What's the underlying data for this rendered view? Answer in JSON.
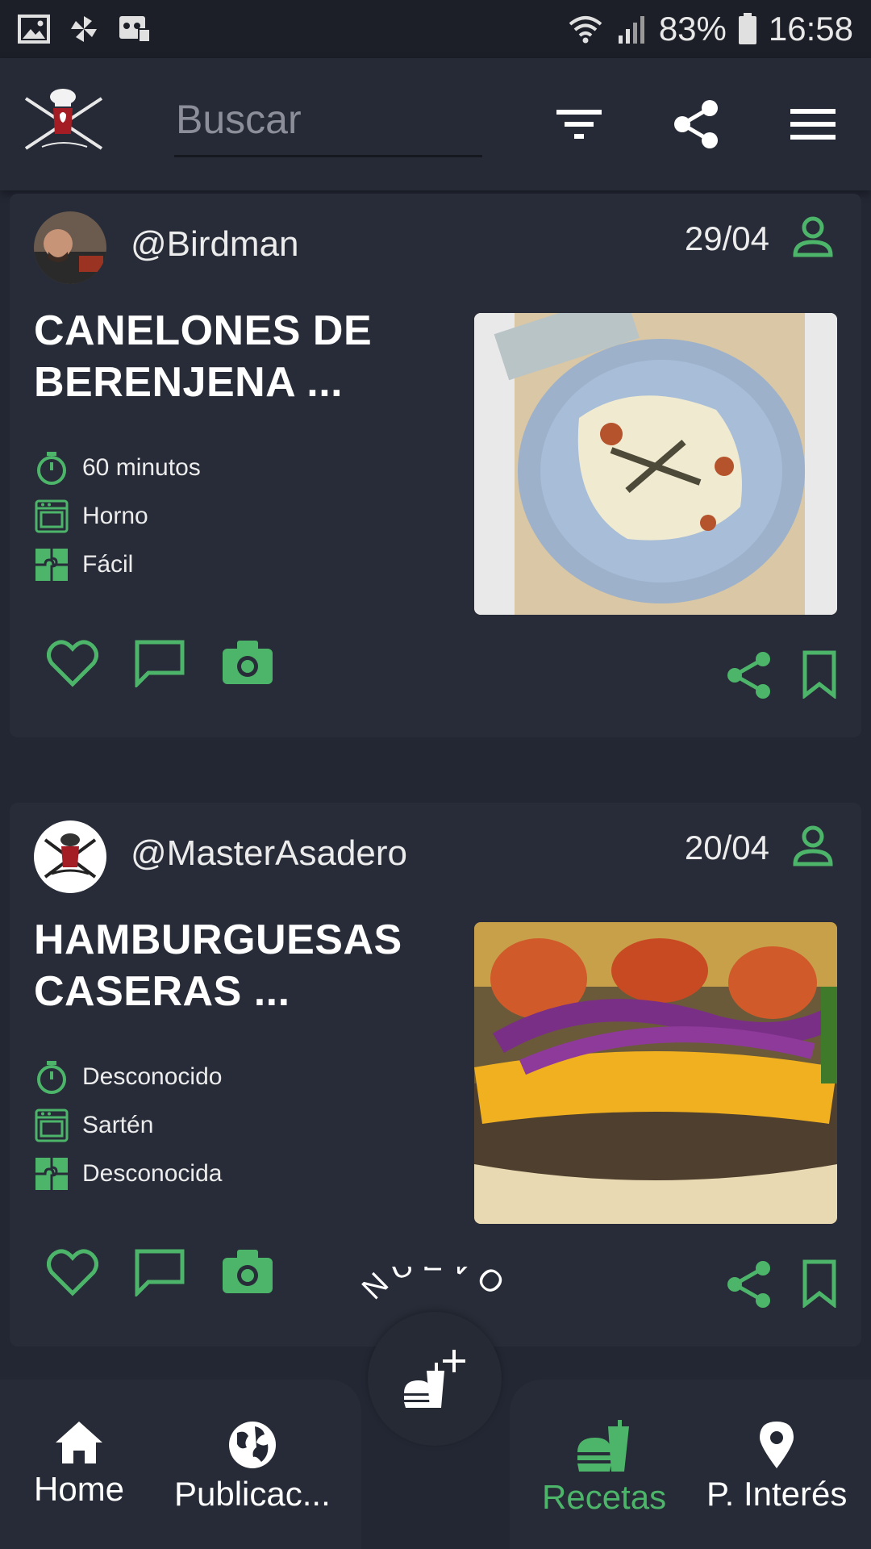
{
  "status_bar": {
    "battery": "83%",
    "time": "16:58"
  },
  "search": {
    "placeholder": "Buscar"
  },
  "posts": [
    {
      "username": "@Birdman",
      "date": "29/04",
      "title_line1": "CANELONES DE",
      "title_line2": "BERENJENA ...",
      "time": "60 minutos",
      "method": "Horno",
      "difficulty": "Fácil"
    },
    {
      "username": "@MasterAsadero",
      "date": "20/04",
      "title_line1": "HAMBURGUESAS",
      "title_line2": "CASERAS ...",
      "time": "Desconocido",
      "method": "Sartén",
      "difficulty": "Desconocida"
    }
  ],
  "fab": {
    "label": "NUEVO"
  },
  "bottom_nav": [
    {
      "label": "Home",
      "icon": "home-icon"
    },
    {
      "label": "Publicac...",
      "icon": "globe-icon"
    },
    {
      "label": "Recetas",
      "icon": "burger-drink-icon",
      "active": true
    },
    {
      "label": "P. Interés",
      "icon": "map-pin-icon"
    }
  ],
  "colors": {
    "accent": "#4db56a",
    "background": "#232733",
    "card": "#272c38"
  }
}
